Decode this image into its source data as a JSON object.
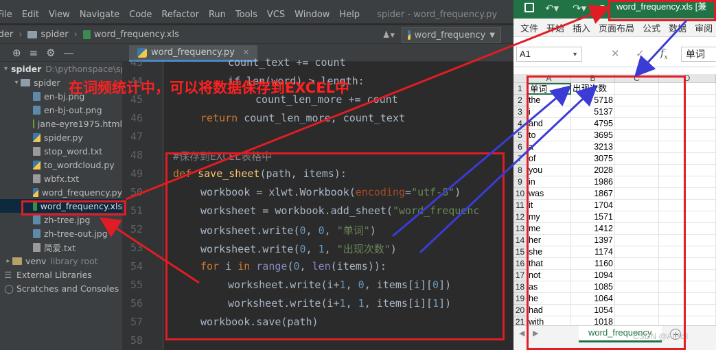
{
  "ide": {
    "menu": [
      "File",
      "Edit",
      "View",
      "Navigate",
      "Code",
      "Refactor",
      "Run",
      "Tools",
      "VCS",
      "Window",
      "Help"
    ],
    "title": "spider - word_frequency.py",
    "breadcrumb": {
      "root": "ider",
      "folder": "spider",
      "file": "word_frequency.xls"
    },
    "run_config": "word_frequency",
    "project_tree": {
      "root_label": "spider",
      "root_path": "D:\\pythonspace\\sp",
      "folder": "spider",
      "files": [
        "en-bj.png",
        "en-bj-out.png",
        "jane-eyre1975.html",
        "spider.py",
        "stop_word.txt",
        "to_wordcloud.py",
        "wbfx.txt",
        "word_frequency.py",
        "word_frequency.xls",
        "zh-tree.jpg",
        "zh-tree-out.jpg",
        "简爱.txt"
      ],
      "venv": "venv",
      "venv_note": "library root",
      "external": "External Libraries",
      "scratches": "Scratches and Consoles"
    },
    "editor_tab": "word_frequency.py",
    "line_numbers": [
      "43",
      "44",
      "45",
      "46",
      "47",
      "48",
      "49",
      "50",
      "51",
      "52",
      "53",
      "54",
      "55",
      "56",
      "57",
      "58"
    ],
    "code": {
      "l43": "count_text += count",
      "l44a": "if len(word) > length:",
      "l45": "count_len_more += count",
      "l46_kw": "return",
      "l46": " count_len_more, count_text",
      "l48": "#保存到EXCEL表格中",
      "l49_kw": "def",
      "l49_fn": "save_sheet",
      "l49": "(path, items):",
      "l50a": "workbook = xlwt.Workbook(",
      "l50_kwa": "encoding",
      "l50_eq": "=",
      "l50_str": "\"utf-8\"",
      "l50_end": ")",
      "l51a": "worksheet = workbook.add_sheet(",
      "l51_str": "\"word_frequenc",
      "l52a": "worksheet.write(",
      "l52_n1": "0",
      "l52_c": ", ",
      "l52_n2": "0",
      "l52_str": "\"单词\"",
      "l52_end": ")",
      "l53a": "worksheet.write(",
      "l53_n1": "0",
      "l53_n2": "1",
      "l53_str": "\"出现次数\"",
      "l54_kw1": "for",
      "l54_a": " i ",
      "l54_kw2": "in",
      "l54_bi": " range",
      "l54_b": "(",
      "l54_n": "0",
      "l54_c": ", ",
      "l54_bi2": "len",
      "l54_d": "(items)):",
      "l55a": "worksheet.write(i+",
      "l55_n1": "1",
      "l55_b": ", ",
      "l55_n2": "0",
      "l55_c": ", items[i][",
      "l55_n3": "0",
      "l55_d": "])",
      "l56a": "worksheet.write(i+",
      "l56_n1": "1",
      "l56_n2": "1",
      "l56_n3": "1",
      "l57": "workbook.save(path)"
    },
    "annotation": "在词频统计中，可以将数据保存到EXCEL中"
  },
  "excel": {
    "doc_title": "word_frequency.xls  [兼",
    "ribbon": [
      "文件",
      "开始",
      "插入",
      "页面布局",
      "公式",
      "数据",
      "审阅"
    ],
    "name_box": "A1",
    "formula_value": "单词",
    "columns": [
      "A",
      "B",
      "C",
      "D"
    ],
    "rows": [
      {
        "n": "1",
        "word": "单词",
        "count": "出现次数"
      },
      {
        "n": "2",
        "word": "the",
        "count": "5718"
      },
      {
        "n": "3",
        "word": "i",
        "count": "5137"
      },
      {
        "n": "4",
        "word": "and",
        "count": "4795"
      },
      {
        "n": "5",
        "word": "to",
        "count": "3695"
      },
      {
        "n": "6",
        "word": "a",
        "count": "3213"
      },
      {
        "n": "7",
        "word": "of",
        "count": "3075"
      },
      {
        "n": "8",
        "word": "you",
        "count": "2028"
      },
      {
        "n": "9",
        "word": "in",
        "count": "1986"
      },
      {
        "n": "10",
        "word": "was",
        "count": "1867"
      },
      {
        "n": "11",
        "word": "it",
        "count": "1704"
      },
      {
        "n": "12",
        "word": "my",
        "count": "1571"
      },
      {
        "n": "13",
        "word": "me",
        "count": "1412"
      },
      {
        "n": "14",
        "word": "her",
        "count": "1397"
      },
      {
        "n": "15",
        "word": "she",
        "count": "1174"
      },
      {
        "n": "16",
        "word": "that",
        "count": "1160"
      },
      {
        "n": "17",
        "word": "not",
        "count": "1094"
      },
      {
        "n": "18",
        "word": "as",
        "count": "1085"
      },
      {
        "n": "19",
        "word": "he",
        "count": "1064"
      },
      {
        "n": "20",
        "word": "had",
        "count": "1054"
      },
      {
        "n": "21",
        "word": "with",
        "count": "1018"
      }
    ],
    "sheet_tab": "word_frequency",
    "watermark": "CSDN @AIBcll"
  },
  "colors": {
    "annotation_red": "#e01d24",
    "arrow_blue": "#3b3bd6",
    "excel_green": "#217346"
  }
}
